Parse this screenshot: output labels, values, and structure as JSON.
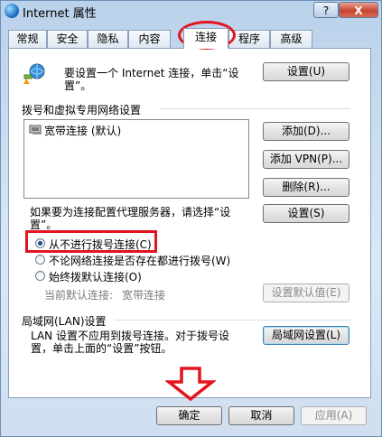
{
  "window": {
    "title": "Internet 属性",
    "help_label": "?",
    "close_label": "X"
  },
  "tabs": [
    {
      "label": "常规"
    },
    {
      "label": "安全"
    },
    {
      "label": "隐私"
    },
    {
      "label": "内容"
    },
    {
      "label": "连接",
      "active": true
    },
    {
      "label": "程序"
    },
    {
      "label": "高级"
    }
  ],
  "setup": {
    "text_line1": "要设置一个 Internet 连接，单击“设",
    "text_line2": "置”。",
    "button": "设置(U)"
  },
  "dialup": {
    "header": "拨号和虚拟专用网络设置",
    "list_items": [
      "宽带连接 (默认)"
    ],
    "add_button": "添加(D)...",
    "add_vpn_button": "添加 VPN(P)...",
    "delete_button": "删除(R)...",
    "proxy_text_line1": "如果要为连接配置代理服务器，请选择“设",
    "proxy_text_line2": "置”。",
    "settings_button": "设置(S)",
    "options": [
      {
        "label": "从不进行拨号连接(C)",
        "checked": true
      },
      {
        "label": "不论网络连接是否存在都进行拨号(W)",
        "checked": false
      },
      {
        "label": "始终拨默认连接(O)",
        "checked": false
      }
    ],
    "current_default_label": "当前默认连接:",
    "current_default_value": "宽带连接",
    "set_default_button": "设置默认值(E)"
  },
  "lan": {
    "header": "局域网(LAN)设置",
    "text_line1": "LAN 设置不应用到拨号连接。对于拨号设",
    "text_line2": "置，单击上面的“设置”按钮。",
    "button": "局域网设置(L)"
  },
  "footer": {
    "ok": "确定",
    "cancel": "取消",
    "apply": "应用(A)"
  },
  "annotations": {
    "color": "#e3141e"
  }
}
